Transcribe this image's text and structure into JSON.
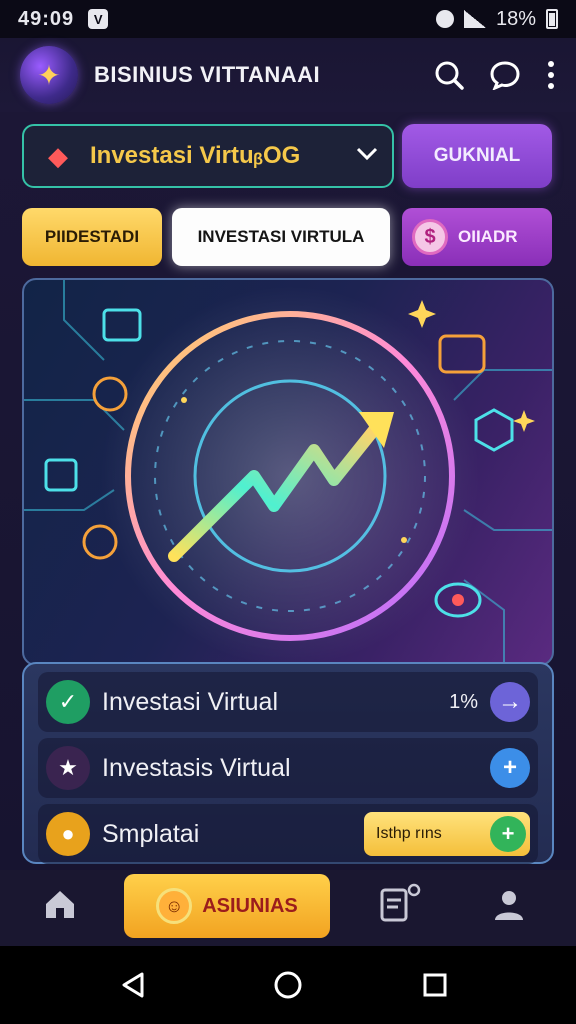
{
  "status_bar": {
    "time": "49:09",
    "battery": "18%"
  },
  "header": {
    "title": "BISINIUS VITTANAAI"
  },
  "selector": {
    "label": "Investasi VirtuᵦOG"
  },
  "buttons": {
    "gukial": "GUKNIAL"
  },
  "tabs": [
    {
      "label": "PIIDESTADI"
    },
    {
      "label": "INVESTASI VIRTULA"
    },
    {
      "label": "OIIADR"
    }
  ],
  "list": [
    {
      "label": "Investasi Virtual",
      "value": "1%"
    },
    {
      "label": "Investasis Virtual"
    },
    {
      "label": "Smplatai",
      "action": "Isthp rıns"
    }
  ],
  "bottom_nav": {
    "active_label": "ASIUNIAS"
  },
  "colors": {
    "accent_gold": "#f5c84a",
    "accent_purple": "#a25ae6",
    "accent_teal": "#35c2a7"
  }
}
